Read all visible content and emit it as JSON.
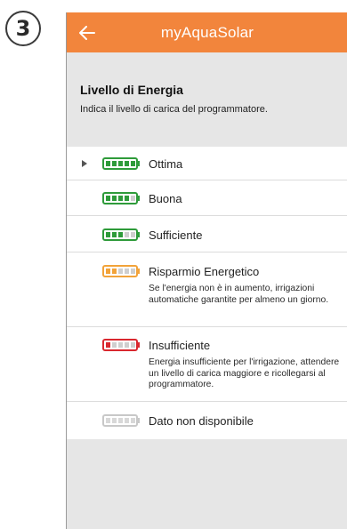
{
  "step": {
    "number": "3"
  },
  "appbar": {
    "title": "myAquaSolar",
    "back_icon": "arrow-left-icon"
  },
  "section": {
    "title": "Livello di Energia",
    "subtitle": "Indica il livello di carica del programmatore."
  },
  "levels": [
    {
      "label": "Ottima",
      "description": "",
      "bars_filled": 5,
      "color": "#2e9b3a",
      "selected": true
    },
    {
      "label": "Buona",
      "description": "",
      "bars_filled": 4,
      "color": "#2e9b3a",
      "selected": false
    },
    {
      "label": "Sufficiente",
      "description": "",
      "bars_filled": 3,
      "color": "#2e9b3a",
      "selected": false
    },
    {
      "label": "Risparmio Energetico",
      "description": "Se l'energia non è in aumento, irrigazioni automatiche garantite per almeno un giorno.",
      "bars_filled": 2,
      "color": "#f2a33a",
      "selected": false
    },
    {
      "label": "Insufficiente",
      "description": "Energia insufficiente per l'irrigazione, attendere un livello di carica maggiore e ricollegarsi al programmatore.",
      "bars_filled": 1,
      "color": "#d9282f",
      "selected": false
    },
    {
      "label": "Dato non disponibile",
      "description": "",
      "bars_filled": 0,
      "color": "#c8c8c8",
      "selected": false
    }
  ],
  "colors": {
    "accent": "#f2853c",
    "background": "#e6e6e6",
    "empty_bar": "#cfcfcf"
  }
}
